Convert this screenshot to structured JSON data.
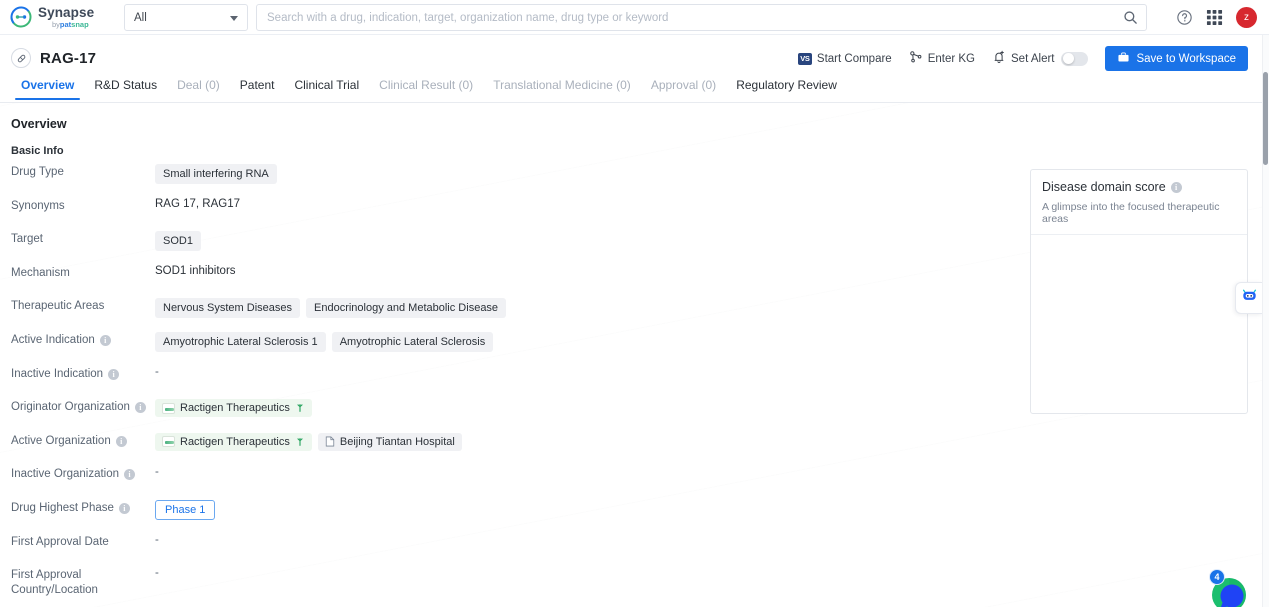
{
  "header": {
    "logo_name": "Synapse",
    "logo_by": "by",
    "logo_brand_a": "pat",
    "logo_brand_b": "snap",
    "scope_value": "All",
    "search_placeholder": "Search with a drug, indication, target, organization name, drug type or keyword",
    "search_value": "",
    "avatar_initial": "z",
    "icons": {
      "search": "search-icon",
      "help": "help-circle-icon",
      "apps": "grid-apps-icon"
    }
  },
  "drug": {
    "name": "RAG-17",
    "icon": "capsule-icon"
  },
  "actions": {
    "start_compare": "Start Compare",
    "start_compare_badge": "VS",
    "enter_kg": "Enter KG",
    "set_alert": "Set Alert",
    "set_alert_on": false,
    "save_to_workspace": "Save to Workspace"
  },
  "tabs": [
    {
      "label": "Overview",
      "state": "active"
    },
    {
      "label": "R&D Status",
      "state": "normal"
    },
    {
      "label": "Deal (0)",
      "state": "muted"
    },
    {
      "label": "Patent",
      "state": "normal"
    },
    {
      "label": "Clinical Trial",
      "state": "normal"
    },
    {
      "label": "Clinical Result (0)",
      "state": "muted"
    },
    {
      "label": "Translational Medicine (0)",
      "state": "muted"
    },
    {
      "label": "Approval (0)",
      "state": "muted"
    },
    {
      "label": "Regulatory Review",
      "state": "normal"
    }
  ],
  "overview": {
    "section_title": "Overview",
    "subsection_title": "Basic Info",
    "rows": [
      {
        "label": "Drug Type",
        "info": false,
        "kind": "tags",
        "values": [
          "Small interfering RNA"
        ]
      },
      {
        "label": "Synonyms",
        "info": false,
        "kind": "text",
        "values": [
          "RAG 17,  RAG17"
        ]
      },
      {
        "label": "Target",
        "info": false,
        "kind": "tags",
        "values": [
          "SOD1"
        ]
      },
      {
        "label": "Mechanism",
        "info": false,
        "kind": "text",
        "values": [
          "SOD1 inhibitors"
        ]
      },
      {
        "label": "Therapeutic Areas",
        "info": false,
        "kind": "tags",
        "values": [
          "Nervous System Diseases",
          "Endocrinology and Metabolic Disease"
        ]
      },
      {
        "label": "Active Indication",
        "info": true,
        "kind": "tags",
        "values": [
          "Amyotrophic Lateral Sclerosis 1",
          "Amyotrophic Lateral Sclerosis"
        ]
      },
      {
        "label": "Inactive Indication",
        "info": true,
        "kind": "empty",
        "values": [
          "-"
        ]
      },
      {
        "label": "Originator Organization",
        "info": true,
        "kind": "orgs",
        "values": [
          "Ractigen Therapeutics"
        ]
      },
      {
        "label": "Active Organization",
        "info": true,
        "kind": "orgs-mixed",
        "values": [
          "Ractigen Therapeutics",
          "Beijing Tiantan Hospital"
        ]
      },
      {
        "label": "Inactive Organization",
        "info": true,
        "kind": "empty",
        "values": [
          "-"
        ]
      },
      {
        "label": "Drug Highest Phase",
        "info": true,
        "kind": "phase",
        "values": [
          "Phase 1"
        ]
      },
      {
        "label": "First Approval Date",
        "info": false,
        "kind": "empty",
        "values": [
          "-"
        ]
      },
      {
        "label": "First Approval Country/Location",
        "info": false,
        "kind": "empty",
        "values": [
          "-"
        ]
      }
    ]
  },
  "side_panel": {
    "title": "Disease domain score",
    "description": "A glimpse into the focused therapeutic areas",
    "info": true
  },
  "chat": {
    "badge_count": "4",
    "bot_icon": "robot-icon"
  },
  "colors": {
    "accent": "#1a73e8",
    "avatar": "#d7282f",
    "org_tag_bg": "#eef7ef",
    "tag_bg": "#f0f1f4"
  }
}
